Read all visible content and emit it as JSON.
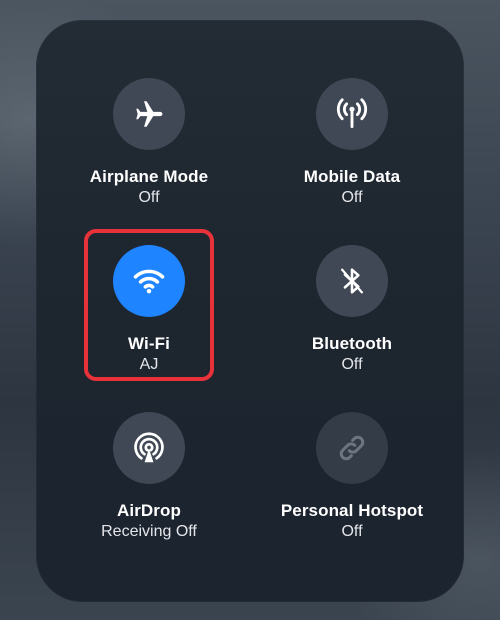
{
  "tiles": [
    {
      "label": "Airplane Mode",
      "status": "Off",
      "icon": "airplane-icon",
      "active": false
    },
    {
      "label": "Mobile Data",
      "status": "Off",
      "icon": "antenna-icon",
      "active": false
    },
    {
      "label": "Wi-Fi",
      "status": "AJ",
      "icon": "wifi-icon",
      "active": true
    },
    {
      "label": "Bluetooth",
      "status": "Off",
      "icon": "bluetooth-icon",
      "active": false
    },
    {
      "label": "AirDrop",
      "status": "Receiving Off",
      "icon": "airdrop-icon",
      "active": false
    },
    {
      "label": "Personal Hotspot",
      "status": "Off",
      "icon": "link-icon",
      "active": false
    }
  ],
  "colors": {
    "active": "#1e84ff",
    "inactive": "#3f4854",
    "disabled": "#343c47",
    "highlight": "#e8323a"
  }
}
